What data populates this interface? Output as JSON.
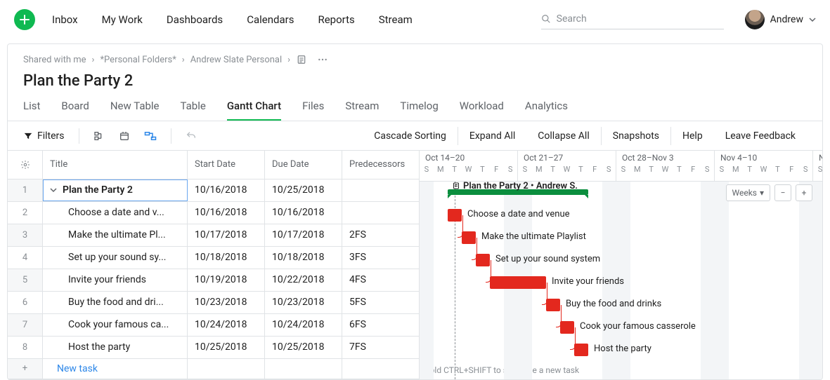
{
  "topnav": {
    "inbox": "Inbox",
    "mywork": "My Work",
    "dash": "Dashboards",
    "cal": "Calendars",
    "reports": "Reports",
    "stream": "Stream"
  },
  "search_placeholder": "Search",
  "user_name": "Andrew",
  "breadcrumbs": [
    "Shared with me",
    "*Personal Folders*",
    "Andrew Slate Personal"
  ],
  "page_title": "Plan the Party 2",
  "tabs": [
    "List",
    "Board",
    "New Table",
    "Table",
    "Gantt Chart",
    "Files",
    "Stream",
    "Timelog",
    "Workload",
    "Analytics"
  ],
  "active_tab": "Gantt Chart",
  "toolbar": {
    "filters": "Filters",
    "cascade": "Cascade Sorting",
    "expand": "Expand All",
    "collapse": "Collapse All",
    "snapshots": "Snapshots",
    "help": "Help",
    "feedback": "Leave Feedback"
  },
  "columns": {
    "title": "Title",
    "start": "Start Date",
    "due": "Due Date",
    "pred": "Predecessors"
  },
  "rows": [
    {
      "n": "1",
      "title": "Plan the Party 2",
      "start": "10/16/2018",
      "due": "10/25/2018",
      "pred": "",
      "parent": true,
      "sel": true,
      "display": "Plan the Party 2"
    },
    {
      "n": "2",
      "title": "Choose a date and venue",
      "start": "10/16/2018",
      "due": "10/16/2018",
      "pred": "",
      "display": "Choose a date and v..."
    },
    {
      "n": "3",
      "title": "Make the ultimate Playlist",
      "start": "10/17/2018",
      "due": "10/17/2018",
      "pred": "2FS",
      "display": "Make the ultimate Pl..."
    },
    {
      "n": "4",
      "title": "Set up your sound system",
      "start": "10/18/2018",
      "due": "10/18/2018",
      "pred": "3FS",
      "display": "Set up your sound sy..."
    },
    {
      "n": "5",
      "title": "Invite your friends",
      "start": "10/19/2018",
      "due": "10/22/2018",
      "pred": "4FS",
      "display": "Invite your friends"
    },
    {
      "n": "6",
      "title": "Buy the food and drinks",
      "start": "10/23/2018",
      "due": "10/23/2018",
      "pred": "5FS",
      "display": "Buy the food and dri..."
    },
    {
      "n": "7",
      "title": "Cook your famous casserole",
      "start": "10/24/2018",
      "due": "10/24/2018",
      "pred": "6FS",
      "display": "Cook your famous ca..."
    },
    {
      "n": "8",
      "title": "Host the party",
      "start": "10/25/2018",
      "due": "10/25/2018",
      "pred": "7FS",
      "display": "Host the party"
    }
  ],
  "new_task": "New task",
  "weeks": [
    {
      "label": "Oct 14–20",
      "days": [
        "S",
        "M",
        "T",
        "W",
        "T",
        "F",
        "S"
      ]
    },
    {
      "label": "Oct 21–27",
      "days": [
        "S",
        "M",
        "T",
        "W",
        "T",
        "F",
        "S"
      ]
    },
    {
      "label": "Oct 28–Nov 3",
      "days": [
        "S",
        "M",
        "T",
        "W",
        "T",
        "F",
        "S"
      ]
    },
    {
      "label": "Nov 4–10",
      "days": [
        "S",
        "M",
        "T",
        "W",
        "T",
        "F",
        "S"
      ]
    },
    {
      "label": "N",
      "days": [
        "S"
      ]
    }
  ],
  "scale_label": "Weeks",
  "gantt_hint": "Hold CTRL+SHIFT to schedule a new task",
  "summary_label": "Plan the Party 2 • Andrew S.",
  "bar_labels": {
    "b2": "Choose a date and venue",
    "b3": "Make the ultimate Playlist",
    "b4": "Set up your sound system",
    "b5": "Invite your friends",
    "b6": "Buy the food and drinks",
    "b7": "Cook your famous casserole",
    "b8": "Host the party"
  },
  "chart_data": {
    "type": "gantt",
    "start": "2018-10-14",
    "tasks": [
      {
        "id": 1,
        "name": "Plan the Party 2",
        "start": "2018-10-16",
        "end": "2018-10-25",
        "summary": true,
        "assignee": "Andrew S."
      },
      {
        "id": 2,
        "name": "Choose a date and venue",
        "start": "2018-10-16",
        "end": "2018-10-16",
        "dep": null
      },
      {
        "id": 3,
        "name": "Make the ultimate Playlist",
        "start": "2018-10-17",
        "end": "2018-10-17",
        "dep": "2FS"
      },
      {
        "id": 4,
        "name": "Set up your sound system",
        "start": "2018-10-18",
        "end": "2018-10-18",
        "dep": "3FS"
      },
      {
        "id": 5,
        "name": "Invite your friends",
        "start": "2018-10-19",
        "end": "2018-10-22",
        "dep": "4FS"
      },
      {
        "id": 6,
        "name": "Buy the food and drinks",
        "start": "2018-10-23",
        "end": "2018-10-23",
        "dep": "5FS"
      },
      {
        "id": 7,
        "name": "Cook your famous casserole",
        "start": "2018-10-24",
        "end": "2018-10-24",
        "dep": "6FS"
      },
      {
        "id": 8,
        "name": "Host the party",
        "start": "2018-10-25",
        "end": "2018-10-25",
        "dep": "7FS"
      }
    ]
  }
}
